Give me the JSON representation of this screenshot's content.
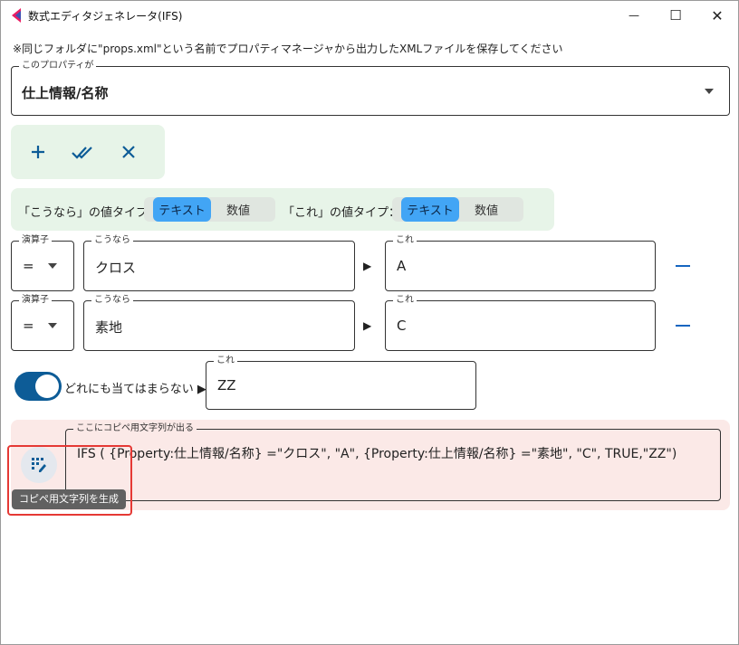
{
  "window": {
    "title": "数式エディタジェネレータ(IFS)",
    "minimize_glyph": "—",
    "maximize_glyph": "☐",
    "close_glyph": "✕"
  },
  "note": "※同じフォルダに\"props.xml\"という名前でプロパティマネージャから出力したXMLファイルを保存してください",
  "property_select": {
    "label": "このプロパティが",
    "value": "仕上情報/名称"
  },
  "toolbar": {
    "add_glyph": "+",
    "check_glyph": "✔✔",
    "clear_glyph": "✕"
  },
  "type_selectors": {
    "kounara_label": "「こうなら」の値タイプ：",
    "kore_label": "「これ」の値タイプ：",
    "options": [
      "テキスト",
      "数値"
    ],
    "kounara_selected": "テキスト",
    "kore_selected": "テキスト"
  },
  "rows": [
    {
      "operator_label": "演算子",
      "operator": "=",
      "kounara_label": "こうなら",
      "kounara": "クロス",
      "arrow": "▶",
      "kore_label": "これ",
      "kore": "A"
    },
    {
      "operator_label": "演算子",
      "operator": "=",
      "kounara_label": "こうなら",
      "kounara": "素地",
      "arrow": "▶",
      "kore_label": "これ",
      "kore": "C"
    }
  ],
  "default_row": {
    "toggle_on": true,
    "text": "どれにも当てはまらない ▶",
    "kore_label": "これ",
    "kore": "ZZ"
  },
  "output": {
    "label": "ここにコピペ用文字列が出る",
    "text": "IFS ( {Property:仕上情報/名称} =\"クロス\", \"A\", {Property:仕上情報/名称} =\"素地\", \"C\", TRUE,\"ZZ\")",
    "generate_tooltip": "コピペ用文字列を生成"
  },
  "colors": {
    "accent": "#42a5f5",
    "toggle": "#0d5c97",
    "toolbar_icon": "#0d5c97",
    "panel_green": "#e7f4e8",
    "panel_red": "#fbe9e7",
    "highlight": "#e53935"
  }
}
